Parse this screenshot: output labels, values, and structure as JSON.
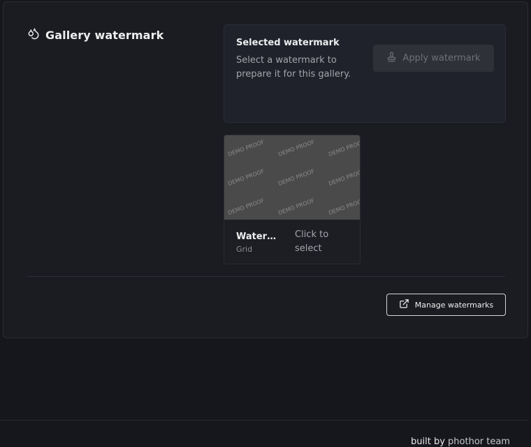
{
  "header": {
    "title": "Gallery watermark",
    "icon": "droplets-icon"
  },
  "selected": {
    "label": "Selected watermark",
    "description": "Select a watermark to prepare it for this gallery.",
    "apply_label": "Apply watermark",
    "apply_icon": "stamp-icon"
  },
  "watermarks": [
    {
      "name": "Watermark",
      "type": "Grid",
      "hint": "Click to select",
      "tile_text": "DEMO PROOF"
    }
  ],
  "footer_actions": {
    "manage_label": "Manage watermarks",
    "manage_icon": "external-link-icon"
  },
  "footer": {
    "prefix": "built by",
    "team": "phothor team"
  },
  "colors": {
    "background": "#16171c",
    "panel": "#1f222b",
    "thumb": "#4a4a4a"
  }
}
